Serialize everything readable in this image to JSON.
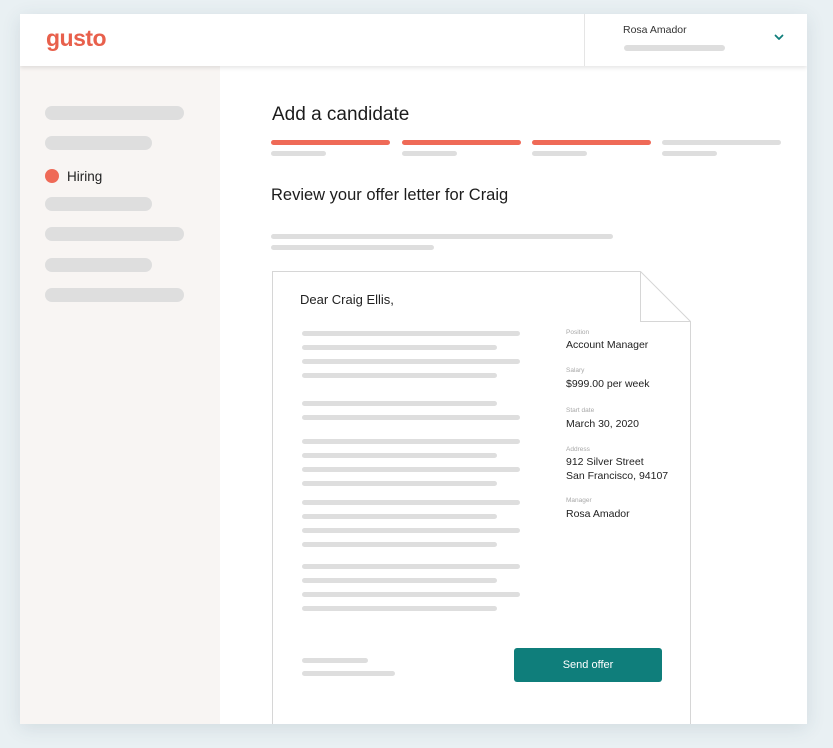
{
  "brand": {
    "logo_text": "gusto",
    "accent_color": "#e8604c"
  },
  "account": {
    "user_name": "Rosa Amador",
    "menu_icon": "chevron-down-icon"
  },
  "sidebar": {
    "active_item": {
      "label": "Hiring",
      "icon": "dot-icon",
      "color": "#ef6a57"
    }
  },
  "page": {
    "title": "Add a candidate",
    "progress": {
      "steps_total": 4,
      "steps_completed": 3
    },
    "section_title": "Review your offer letter for Craig"
  },
  "letter": {
    "greeting": "Dear Craig Ellis,",
    "fields": [
      {
        "label": "Position",
        "value": "Account Manager"
      },
      {
        "label": "Salary",
        "value": "$999.00 per week"
      },
      {
        "label": "Start date",
        "value": "March 30, 2020"
      },
      {
        "label": "Address",
        "value": "912 Silver Street",
        "value2": "San Francisco, 94107"
      },
      {
        "label": "Manager",
        "value": "Rosa Amador"
      }
    ],
    "send_button_label": "Send offer",
    "button_color": "#0f7e7b"
  }
}
